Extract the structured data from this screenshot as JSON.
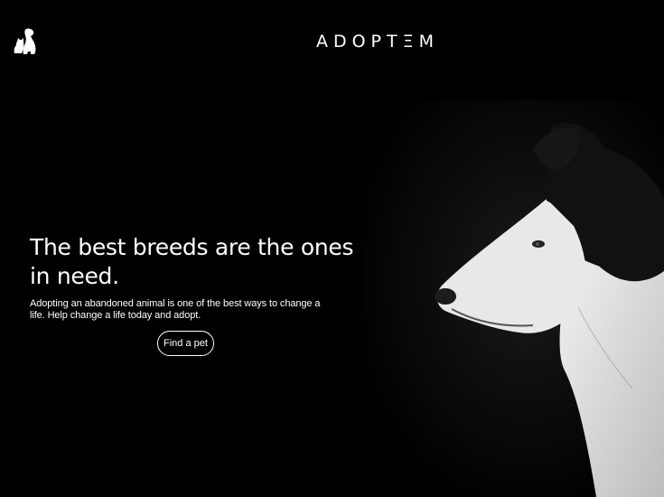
{
  "header": {
    "logo_icon": "dog-cat-silhouette-icon",
    "brand": "ADOPTΞM"
  },
  "hero": {
    "title": "The best breeds are the ones in need.",
    "description": "Adopting an abandoned animal is one of the best ways to change a life. Help change a life today and adopt.",
    "cta_label": "Find a pet",
    "image": "black-and-white-dog-profile-photo"
  },
  "colors": {
    "background": "#000000",
    "text": "#ffffff"
  }
}
